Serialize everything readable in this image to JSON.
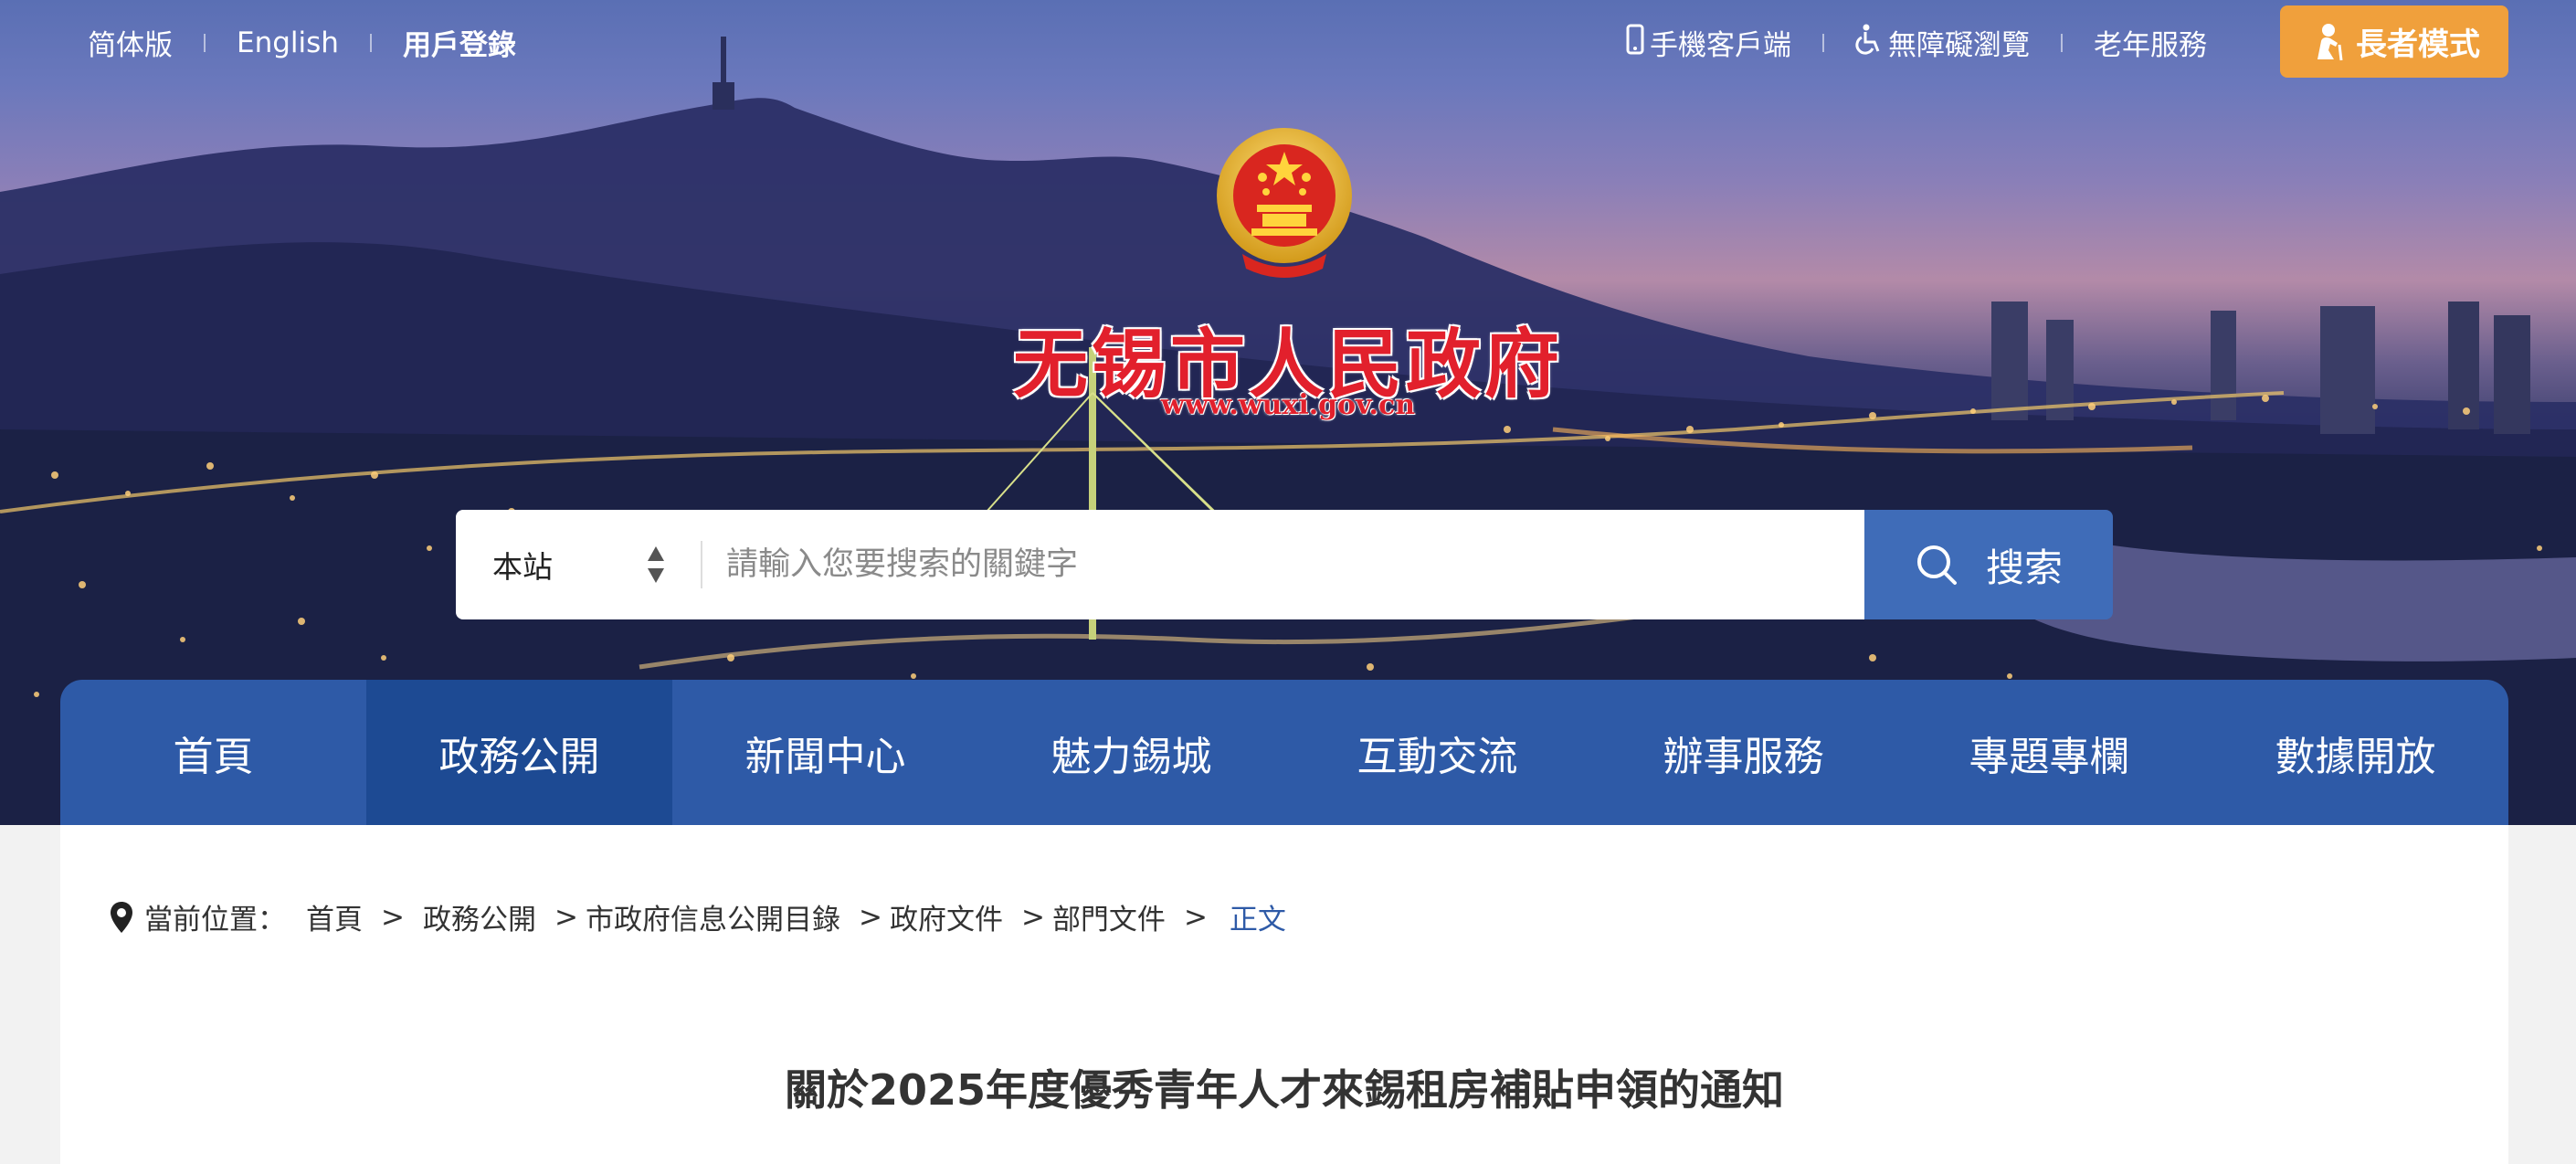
{
  "topbar": {
    "left_links": [
      "简体版",
      "English",
      "用戶登錄"
    ],
    "mobile_label": "手機客戶端",
    "accessibility_label": "無障礙瀏覽",
    "elderly_service_label": "老年服務",
    "elder_mode_label": "長者模式"
  },
  "site": {
    "title": "无锡市人民政府",
    "url": "www.wuxi.gov.cn"
  },
  "search": {
    "scope_value": "本站",
    "placeholder": "請輸入您要搜索的關鍵字",
    "button_label": "搜索"
  },
  "nav": {
    "items": [
      "首頁",
      "政務公開",
      "新聞中心",
      "魅力錫城",
      "互動交流",
      "辦事服務",
      "專題專欄",
      "數據開放"
    ],
    "active_index": 1
  },
  "breadcrumb": {
    "prefix": "當前位置：",
    "items": [
      "首頁",
      "政務公開",
      "市政府信息公開目錄",
      "政府文件",
      "部門文件"
    ],
    "separator": ">",
    "current": "正文"
  },
  "article": {
    "title": "關於2025年度優秀青年人才來錫租房補貼申領的通知"
  },
  "colors": {
    "nav_bg": "#2e5aa7",
    "nav_active": "#1d4a93",
    "search_button": "#3f6cb8",
    "elder_button": "#f0a03c",
    "title_red": "#e2202c",
    "breadcrumb_current": "#2e5aa7"
  }
}
